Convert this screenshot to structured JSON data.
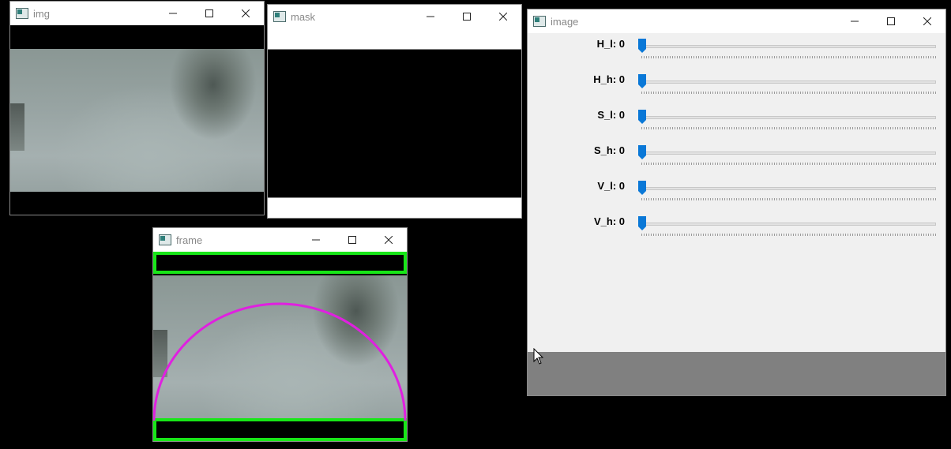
{
  "windows": {
    "img": {
      "title": "img"
    },
    "mask": {
      "title": "mask"
    },
    "frame": {
      "title": "frame"
    },
    "image": {
      "title": "image"
    }
  },
  "controls": {
    "minimize_icon": "minimize-icon",
    "maximize_icon": "maximize-icon",
    "close_icon": "close-icon"
  },
  "trackbars": [
    {
      "label": "H_l: 0",
      "value": 0,
      "min": 0,
      "max": 179
    },
    {
      "label": "H_h: 0",
      "value": 0,
      "min": 0,
      "max": 179
    },
    {
      "label": "S_l: 0",
      "value": 0,
      "min": 0,
      "max": 255
    },
    {
      "label": "S_h: 0",
      "value": 0,
      "min": 0,
      "max": 255
    },
    {
      "label": "V_l: 0",
      "value": 0,
      "min": 0,
      "max": 255
    },
    {
      "label": "V_h: 0",
      "value": 0,
      "min": 0,
      "max": 255
    }
  ],
  "colors": {
    "thumb": "#0a78d7",
    "roi_box": "#18e618",
    "arc": "#e020e0",
    "panel_bg": "#f0f0f0",
    "status_bg": "#808080"
  }
}
